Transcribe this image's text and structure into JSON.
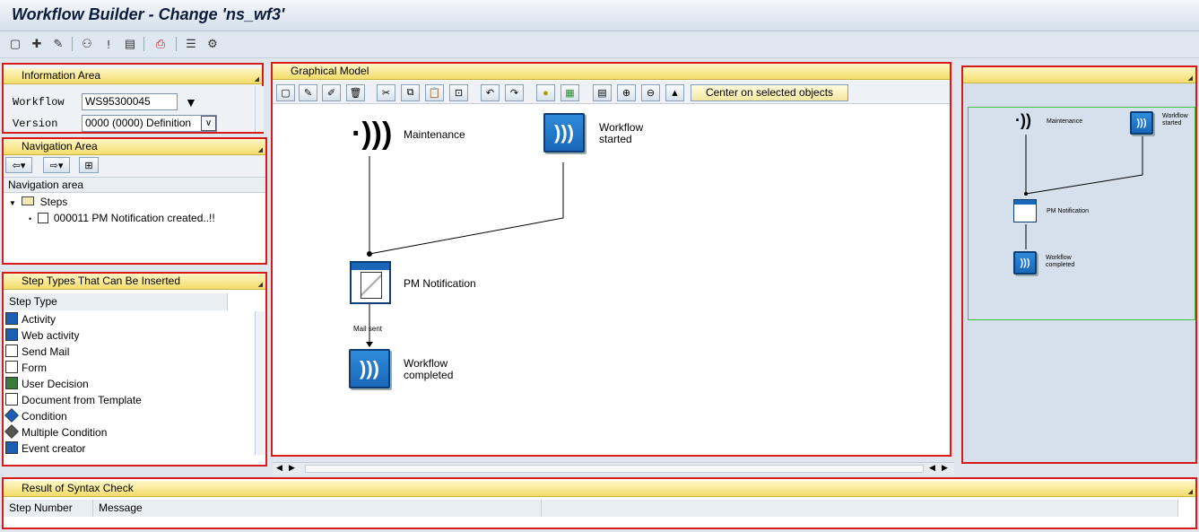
{
  "window": {
    "title": "Workflow Builder - Change 'ns_wf3'"
  },
  "toolbar": {
    "icons": [
      "new-icon",
      "open-icon",
      "edit-icon",
      "hierarchy-icon",
      "marker-icon",
      "display-icon",
      "print-icon",
      "list-icon",
      "settings-icon"
    ]
  },
  "info_area": {
    "title": "Information Area",
    "workflow_label": "Workflow",
    "workflow_value": "WS95300045",
    "version_label": "Version",
    "version_value": "0000 (0000) Definition"
  },
  "nav_area": {
    "title": "Navigation Area",
    "header": "Navigation area",
    "folder": "Steps",
    "item": "000011 PM Notification created..!!"
  },
  "step_types": {
    "title": "Step Types That Can Be Inserted",
    "column": "Step Type",
    "items": [
      "Activity",
      "Web activity",
      "Send Mail",
      "Form",
      "User Decision",
      "Document from Template",
      "Condition",
      "Multiple Condition",
      "Event creator"
    ]
  },
  "graphical": {
    "title": "Graphical Model",
    "center_button": "Center on selected objects",
    "nodes": {
      "maintenance": "Maintenance",
      "wf_started_1": "Workflow",
      "wf_started_2": "started",
      "pm_notification": "PM Notification",
      "mail_sent": "Mail sent",
      "wf_completed_1": "Workflow",
      "wf_completed_2": "completed"
    }
  },
  "syntax": {
    "title": "Result of Syntax Check",
    "col_step": "Step Number",
    "col_message": "Message"
  },
  "colors": {
    "panel_border": "#d71a1a",
    "header_yellow": "#f3dc6a",
    "node_blue": "#1a67b8"
  }
}
